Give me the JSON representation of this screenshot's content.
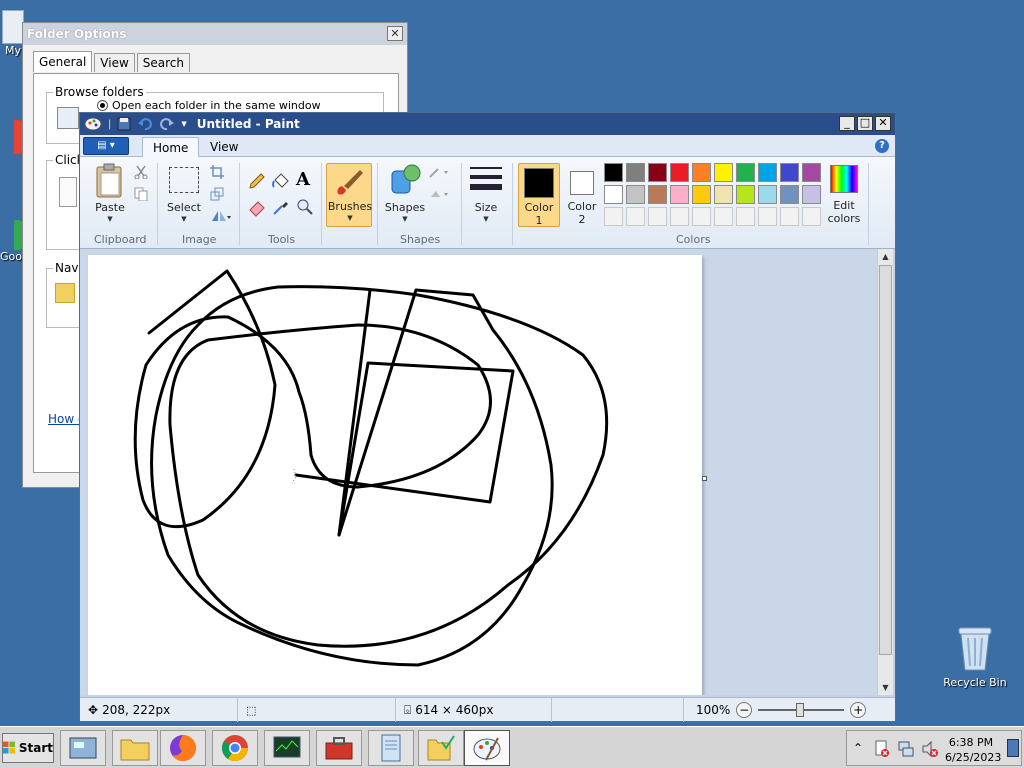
{
  "desktop": {
    "icons": [
      {
        "label": "My"
      },
      {
        "label": "Good"
      },
      {
        "label": "Recycle Bin"
      }
    ]
  },
  "folder_options": {
    "title": "Folder Options",
    "tabs": [
      "General",
      "View",
      "Search"
    ],
    "browse_group": "Browse folders",
    "browse_option": "Open each folder in the same window",
    "click_group": "Click",
    "nav_group": "Navi",
    "link_text": "How d"
  },
  "paint": {
    "title": "Untitled - Paint",
    "tabs": [
      "Home",
      "View"
    ],
    "help": "?",
    "clipboard": {
      "paste": "Paste",
      "group": "Clipboard"
    },
    "image": {
      "select": "Select",
      "group": "Image"
    },
    "tools": {
      "group": "Tools",
      "text_tool": "A"
    },
    "brushes": "Brushes",
    "shapes": {
      "label": "Shapes",
      "group": "Shapes"
    },
    "size": "Size",
    "color1": {
      "label": "Color",
      "num": "1",
      "color": "#000000"
    },
    "color2": {
      "label": "Color",
      "num": "2",
      "color": "#ffffff"
    },
    "colors_group": "Colors",
    "edit_colors": {
      "line1": "Edit",
      "line2": "colors"
    },
    "palette_row1": [
      "#000000",
      "#7f7f7f",
      "#880015",
      "#ed1c24",
      "#ff7f27",
      "#fff200",
      "#22b14c",
      "#00a2e8",
      "#3f48cc",
      "#a349a4"
    ],
    "palette_row2": [
      "#ffffff",
      "#c3c3c3",
      "#b97a57",
      "#ffaec9",
      "#ffc90e",
      "#efe4b0",
      "#b5e61d",
      "#99d9ea",
      "#7092be",
      "#c8bfe7"
    ],
    "status": {
      "cursor_pos": "208, 222px",
      "canvas_size": "614 × 460px",
      "zoom": "100%"
    }
  },
  "taskbar": {
    "start": "Start",
    "time": "6:38 PM",
    "date": "6/25/2023",
    "apps": [
      "server-manager",
      "explorer",
      "firefox",
      "chrome",
      "task-manager",
      "toolbox",
      "notepad",
      "folder-tasks",
      "paint"
    ]
  }
}
